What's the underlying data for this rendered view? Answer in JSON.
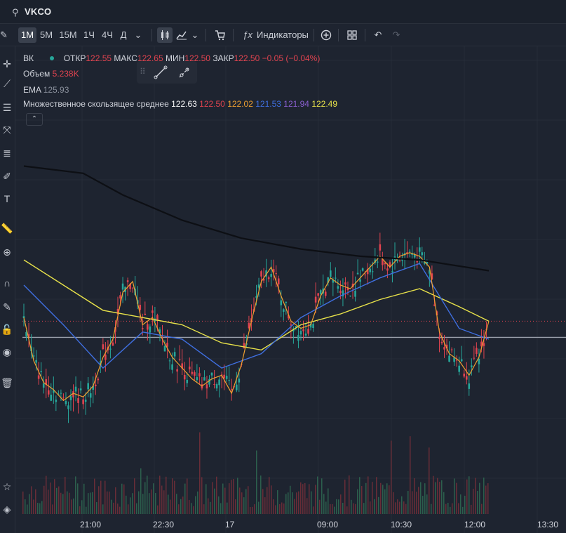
{
  "header": {
    "ticker": "VKCO",
    "search_icon": "search-icon"
  },
  "toolbar": {
    "intervals": [
      "1M",
      "5M",
      "15M",
      "1Ч",
      "4Ч",
      "Д"
    ],
    "active_interval": "1M",
    "indicators_label": "Индикаторы"
  },
  "legend": {
    "symbol": "ВК",
    "open_label": "ОТКР",
    "open": "122.55",
    "high_label": "МАКС",
    "high": "122.65",
    "low_label": "МИН",
    "low": "122.50",
    "close_label": "ЗАКР",
    "close": "122.50",
    "change": "−0.05 (−0.04%)",
    "volume_label": "Объем",
    "volume": "5.238K",
    "ema_label": "EMA",
    "ema": "125.93",
    "mma_label": "Множественное скользящее среднее",
    "mma_values": [
      "122.63",
      "122.50",
      "122.02",
      "121.53",
      "121.94",
      "122.49"
    ],
    "mma_colors": [
      "#ffffff",
      "#e0434f",
      "#f0a030",
      "#3f6fe0",
      "#8a5fd0",
      "#e8e24a"
    ]
  },
  "chart_data": {
    "type": "line",
    "title": "",
    "x_tick_labels": [
      "21:00",
      "22:30",
      "17",
      "09:00",
      "10:30",
      "12:00",
      "13:30"
    ],
    "price_series": [
      {
        "t": 0,
        "v": 122.6
      },
      {
        "t": 1,
        "v": 121.4
      },
      {
        "t": 2,
        "v": 120.8
      },
      {
        "t": 3,
        "v": 120.6
      },
      {
        "t": 4,
        "v": 120.3
      },
      {
        "t": 5,
        "v": 120.5
      },
      {
        "t": 6,
        "v": 120.4
      },
      {
        "t": 7,
        "v": 120.7
      },
      {
        "t": 8,
        "v": 121.5
      },
      {
        "t": 9,
        "v": 122.0
      },
      {
        "t": 10,
        "v": 123.3
      },
      {
        "t": 11,
        "v": 123.6
      },
      {
        "t": 12,
        "v": 122.4
      },
      {
        "t": 13,
        "v": 122.6
      },
      {
        "t": 14,
        "v": 122.0
      },
      {
        "t": 15,
        "v": 121.5
      },
      {
        "t": 16,
        "v": 121.2
      },
      {
        "t": 17,
        "v": 120.9
      },
      {
        "t": 18,
        "v": 120.7
      },
      {
        "t": 19,
        "v": 120.9
      },
      {
        "t": 20,
        "v": 121.0
      },
      {
        "t": 21,
        "v": 120.5
      },
      {
        "t": 22,
        "v": 121.3
      },
      {
        "t": 23,
        "v": 122.5
      },
      {
        "t": 24,
        "v": 123.6
      },
      {
        "t": 25,
        "v": 124.0
      },
      {
        "t": 26,
        "v": 123.2
      },
      {
        "t": 27,
        "v": 122.5
      },
      {
        "t": 28,
        "v": 122.3
      },
      {
        "t": 29,
        "v": 122.4
      },
      {
        "t": 30,
        "v": 123.2
      },
      {
        "t": 31,
        "v": 123.7
      },
      {
        "t": 32,
        "v": 123.5
      },
      {
        "t": 33,
        "v": 123.4
      },
      {
        "t": 34,
        "v": 123.7
      },
      {
        "t": 35,
        "v": 124.0
      },
      {
        "t": 36,
        "v": 124.3
      },
      {
        "t": 37,
        "v": 124.0
      },
      {
        "t": 38,
        "v": 124.3
      },
      {
        "t": 39,
        "v": 124.4
      },
      {
        "t": 40,
        "v": 124.3
      },
      {
        "t": 41,
        "v": 124.0
      },
      {
        "t": 42,
        "v": 122.2
      },
      {
        "t": 43,
        "v": 121.6
      },
      {
        "t": 44,
        "v": 121.4
      },
      {
        "t": 45,
        "v": 121.0
      },
      {
        "t": 46,
        "v": 121.5
      },
      {
        "t": 47,
        "v": 122.5
      }
    ],
    "ema_black": [
      {
        "t": 0,
        "v": 126.8
      },
      {
        "t": 6,
        "v": 126.6
      },
      {
        "t": 10,
        "v": 126.0
      },
      {
        "t": 16,
        "v": 125.3
      },
      {
        "t": 22,
        "v": 124.8
      },
      {
        "t": 28,
        "v": 124.5
      },
      {
        "t": 34,
        "v": 124.3
      },
      {
        "t": 40,
        "v": 124.2
      },
      {
        "t": 47,
        "v": 123.9
      }
    ],
    "ma_yellow": [
      {
        "t": 0,
        "v": 124.2
      },
      {
        "t": 4,
        "v": 123.5
      },
      {
        "t": 8,
        "v": 122.8
      },
      {
        "t": 12,
        "v": 122.6
      },
      {
        "t": 16,
        "v": 122.4
      },
      {
        "t": 20,
        "v": 121.9
      },
      {
        "t": 24,
        "v": 121.7
      },
      {
        "t": 28,
        "v": 122.4
      },
      {
        "t": 32,
        "v": 122.7
      },
      {
        "t": 36,
        "v": 123.1
      },
      {
        "t": 40,
        "v": 123.4
      },
      {
        "t": 44,
        "v": 122.9
      },
      {
        "t": 47,
        "v": 122.5
      }
    ],
    "ma_blue": [
      {
        "t": 0,
        "v": 123.5
      },
      {
        "t": 4,
        "v": 122.4
      },
      {
        "t": 8,
        "v": 121.2
      },
      {
        "t": 12,
        "v": 122.2
      },
      {
        "t": 16,
        "v": 122.0
      },
      {
        "t": 20,
        "v": 121.2
      },
      {
        "t": 24,
        "v": 121.6
      },
      {
        "t": 28,
        "v": 122.6
      },
      {
        "t": 32,
        "v": 123.2
      },
      {
        "t": 36,
        "v": 123.7
      },
      {
        "t": 40,
        "v": 124.1
      },
      {
        "t": 44,
        "v": 122.3
      },
      {
        "t": 47,
        "v": 122.0
      }
    ],
    "horizontal_level": 122.05,
    "current_price_level": 122.5,
    "ylim": [
      119.8,
      127.2
    ]
  }
}
